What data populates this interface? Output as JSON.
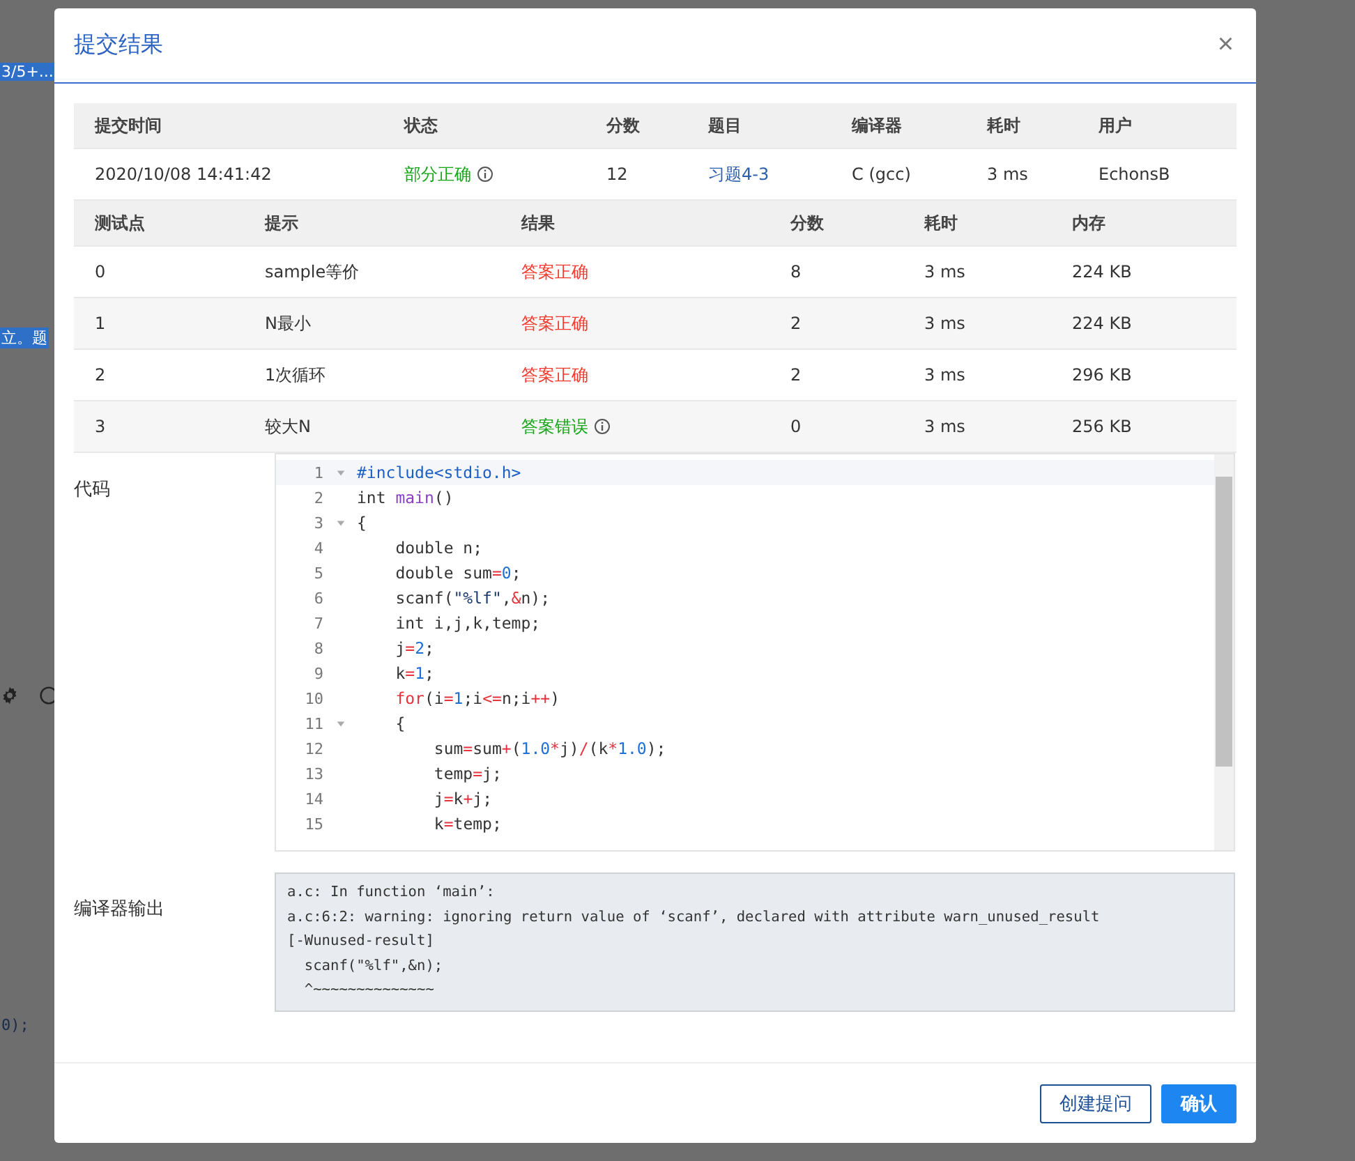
{
  "backdrop": {
    "fragments": [
      "3/5+...",
      "立。题",
      "0);"
    ]
  },
  "dialog": {
    "title": "提交结果",
    "close": "×",
    "summary": {
      "columns": [
        "提交时间",
        "状态",
        "分数",
        "题目",
        "编译器",
        "耗时",
        "用户"
      ],
      "row": {
        "time": "2020/10/08 14:41:42",
        "status": "部分正确",
        "color": "#14a614",
        "score": "12",
        "problem": "习题4-3",
        "compiler": "C (gcc)",
        "duration": "3 ms",
        "user": "EchonsB"
      }
    },
    "tests": {
      "columns": [
        "测试点",
        "提示",
        "结果",
        "分数",
        "耗时",
        "内存"
      ],
      "rows": [
        {
          "id": "0",
          "hint": "sample等价",
          "result": "答案正确",
          "color": "#f5392c",
          "info": false,
          "score": "8",
          "time": "3 ms",
          "memory": "224 KB"
        },
        {
          "id": "1",
          "hint": "N最小",
          "result": "答案正确",
          "color": "#f5392c",
          "info": false,
          "score": "2",
          "time": "3 ms",
          "memory": "224 KB"
        },
        {
          "id": "2",
          "hint": "1次循环",
          "result": "答案正确",
          "color": "#f5392c",
          "info": false,
          "score": "2",
          "time": "3 ms",
          "memory": "296 KB"
        },
        {
          "id": "3",
          "hint": "较大N",
          "result": "答案错误",
          "color": "#14a614",
          "info": true,
          "score": "0",
          "time": "3 ms",
          "memory": "256 KB"
        }
      ]
    },
    "code": {
      "label": "代码",
      "lines": [
        {
          "number": "1",
          "fold": true,
          "tokens": [
            {
              "kind": "pre",
              "t": "#include<stdio.h>"
            }
          ]
        },
        {
          "number": "2",
          "fold": false,
          "tokens": [
            {
              "kind": "plain",
              "t": "int "
            },
            {
              "kind": "fn",
              "t": "main"
            },
            {
              "kind": "plain",
              "t": "()"
            }
          ]
        },
        {
          "number": "3",
          "fold": true,
          "tokens": [
            {
              "kind": "plain",
              "t": "{"
            }
          ]
        },
        {
          "number": "4",
          "fold": false,
          "tokens": [
            {
              "kind": "plain",
              "t": "\tdouble n;"
            }
          ]
        },
        {
          "number": "5",
          "fold": false,
          "tokens": [
            {
              "kind": "plain",
              "t": "\tdouble sum"
            },
            {
              "kind": "op",
              "t": "="
            },
            {
              "kind": "num",
              "t": "0"
            },
            {
              "kind": "plain",
              "t": ";"
            }
          ]
        },
        {
          "number": "6",
          "fold": false,
          "tokens": [
            {
              "kind": "plain",
              "t": "\tscanf("
            },
            {
              "kind": "str",
              "t": "\"%lf\""
            },
            {
              "kind": "plain",
              "t": ","
            },
            {
              "kind": "op",
              "t": "&"
            },
            {
              "kind": "plain",
              "t": "n);"
            }
          ]
        },
        {
          "number": "7",
          "fold": false,
          "tokens": [
            {
              "kind": "plain",
              "t": "\tint i,j,k,temp;"
            }
          ]
        },
        {
          "number": "8",
          "fold": false,
          "tokens": [
            {
              "kind": "plain",
              "t": "\tj"
            },
            {
              "kind": "op",
              "t": "="
            },
            {
              "kind": "num",
              "t": "2"
            },
            {
              "kind": "plain",
              "t": ";"
            }
          ]
        },
        {
          "number": "9",
          "fold": false,
          "tokens": [
            {
              "kind": "plain",
              "t": "\tk"
            },
            {
              "kind": "op",
              "t": "="
            },
            {
              "kind": "num",
              "t": "1"
            },
            {
              "kind": "plain",
              "t": ";"
            }
          ]
        },
        {
          "number": "10",
          "fold": false,
          "tokens": [
            {
              "kind": "kw",
              "t": "\tfor"
            },
            {
              "kind": "plain",
              "t": "(i"
            },
            {
              "kind": "op",
              "t": "="
            },
            {
              "kind": "num",
              "t": "1"
            },
            {
              "kind": "plain",
              "t": ";i"
            },
            {
              "kind": "op",
              "t": "<="
            },
            {
              "kind": "plain",
              "t": "n;i"
            },
            {
              "kind": "op",
              "t": "++"
            },
            {
              "kind": "plain",
              "t": ")"
            }
          ]
        },
        {
          "number": "11",
          "fold": true,
          "tokens": [
            {
              "kind": "plain",
              "t": "\t{"
            }
          ]
        },
        {
          "number": "12",
          "fold": false,
          "tokens": [
            {
              "kind": "plain",
              "t": "\t\tsum"
            },
            {
              "kind": "op",
              "t": "="
            },
            {
              "kind": "plain",
              "t": "sum"
            },
            {
              "kind": "op",
              "t": "+"
            },
            {
              "kind": "plain",
              "t": "("
            },
            {
              "kind": "num",
              "t": "1.0"
            },
            {
              "kind": "op",
              "t": "*"
            },
            {
              "kind": "plain",
              "t": "j)"
            },
            {
              "kind": "op",
              "t": "/"
            },
            {
              "kind": "plain",
              "t": "(k"
            },
            {
              "kind": "op",
              "t": "*"
            },
            {
              "kind": "num",
              "t": "1.0"
            },
            {
              "kind": "plain",
              "t": ");"
            }
          ]
        },
        {
          "number": "13",
          "fold": false,
          "tokens": [
            {
              "kind": "plain",
              "t": "\t\ttemp"
            },
            {
              "kind": "op",
              "t": "="
            },
            {
              "kind": "plain",
              "t": "j;"
            }
          ]
        },
        {
          "number": "14",
          "fold": false,
          "tokens": [
            {
              "kind": "plain",
              "t": "\t\tj"
            },
            {
              "kind": "op",
              "t": "="
            },
            {
              "kind": "plain",
              "t": "k"
            },
            {
              "kind": "op",
              "t": "+"
            },
            {
              "kind": "plain",
              "t": "j;"
            }
          ]
        },
        {
          "number": "15",
          "fold": false,
          "tokens": [
            {
              "kind": "plain",
              "t": "\t\tk"
            },
            {
              "kind": "op",
              "t": "="
            },
            {
              "kind": "plain",
              "t": "temp;"
            }
          ]
        }
      ]
    },
    "compiler_output": {
      "label": "编译器输出",
      "value": "a.c: In function ‘main’:\na.c:6:2: warning: ignoring return value of ‘scanf’, declared with attribute warn_unused_result\n[-Wunused-result]\n  scanf(\"%lf\",&n);\n  ^~~~~~~~~~~~~~~"
    },
    "buttons": [
      {
        "label": "创建提问",
        "kind": "secondary"
      },
      {
        "label": "确认",
        "kind": "primary"
      }
    ]
  }
}
